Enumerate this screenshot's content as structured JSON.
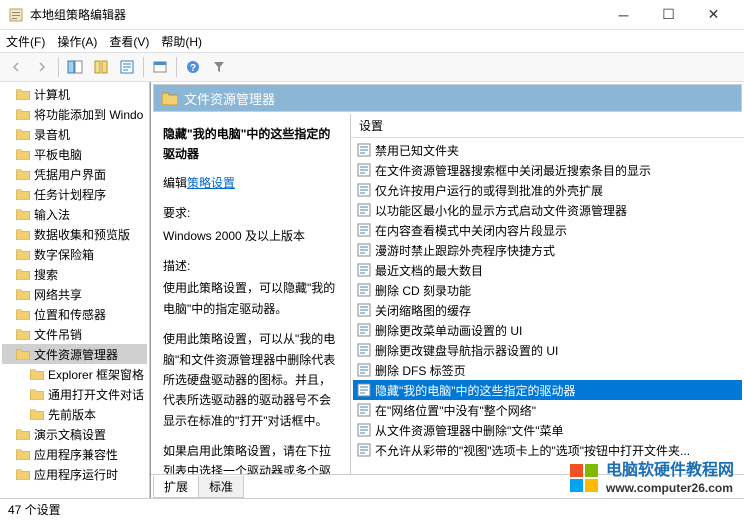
{
  "window": {
    "title": "本地组策略编辑器"
  },
  "menubar": {
    "file": "文件(F)",
    "action": "操作(A)",
    "view": "查看(V)",
    "help": "帮助(H)"
  },
  "tree": {
    "items": [
      {
        "label": "计算机"
      },
      {
        "label": "将功能添加到 Windo"
      },
      {
        "label": "录音机"
      },
      {
        "label": "平板电脑"
      },
      {
        "label": "凭据用户界面"
      },
      {
        "label": "任务计划程序"
      },
      {
        "label": "输入法"
      },
      {
        "label": "数据收集和预览版"
      },
      {
        "label": "数字保险箱"
      },
      {
        "label": "搜索"
      },
      {
        "label": "网络共享"
      },
      {
        "label": "位置和传感器"
      },
      {
        "label": "文件吊销"
      },
      {
        "label": "文件资源管理器",
        "selected": true
      },
      {
        "label": "Explorer 框架窗格",
        "sub": true
      },
      {
        "label": "通用打开文件对话",
        "sub": true
      },
      {
        "label": "先前版本",
        "sub": true
      },
      {
        "label": "演示文稿设置"
      },
      {
        "label": "应用程序兼容性"
      },
      {
        "label": "应用程序运行时"
      }
    ]
  },
  "content": {
    "header": "文件资源管理器",
    "desc": {
      "title": "隐藏\"我的电脑\"中的这些指定的驱动器",
      "edit_label": "编辑",
      "edit_link": "策略设置",
      "req_label": "要求:",
      "req_value": "Windows 2000 及以上版本",
      "desc_label": "描述:",
      "p1": "使用此策略设置，可以隐藏\"我的电脑\"中的指定驱动器。",
      "p2": "使用此策略设置，可以从\"我的电脑\"和文件资源管理器中删除代表所选硬盘驱动器的图标。并且，代表所选驱动器的驱动器号不会显示在标准的\"打开\"对话框中。",
      "p3": "如果启用此策略设置，请在下拉列表中选择一个驱动器或多个驱动器的组合。"
    },
    "settings_header": "设置",
    "settings": [
      {
        "label": "禁用已知文件夹"
      },
      {
        "label": "在文件资源管理器搜索框中关闭最近搜索条目的显示"
      },
      {
        "label": "仅允许按用户运行的或得到批准的外壳扩展"
      },
      {
        "label": "以功能区最小化的显示方式启动文件资源管理器"
      },
      {
        "label": "在内容查看模式中关闭内容片段显示"
      },
      {
        "label": "漫游时禁止跟踪外壳程序快捷方式"
      },
      {
        "label": "最近文档的最大数目"
      },
      {
        "label": "删除 CD 刻录功能"
      },
      {
        "label": "关闭缩略图的缓存"
      },
      {
        "label": "删除更改菜单动画设置的 UI"
      },
      {
        "label": "删除更改键盘导航指示器设置的 UI"
      },
      {
        "label": "删除 DFS 标签页"
      },
      {
        "label": "隐藏\"我的电脑\"中的这些指定的驱动器",
        "selected": true
      },
      {
        "label": "在\"网络位置\"中没有\"整个网络\""
      },
      {
        "label": "从文件资源管理器中删除\"文件\"菜单"
      },
      {
        "label": "不允许从彩带的\"视图\"选项卡上的\"选项\"按钮中打开文件夹..."
      }
    ],
    "tabs": {
      "extended": "扩展",
      "standard": "标准"
    }
  },
  "statusbar": {
    "count": "47 个设置"
  },
  "watermark": {
    "title": "电脑软硬件教程网",
    "url": "www.computer26.com"
  }
}
